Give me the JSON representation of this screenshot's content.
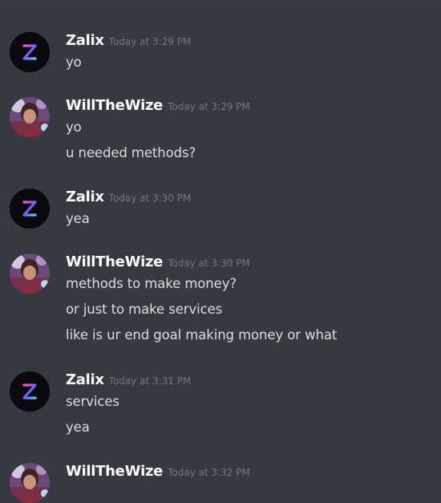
{
  "messages": [
    {
      "author": "Zalix",
      "timestamp": "Today at 3:29 PM",
      "avatar_icon": "z-logo-avatar",
      "lines": [
        "yo"
      ]
    },
    {
      "author": "WillTheWize",
      "timestamp": "Today at 3:29 PM",
      "avatar_icon": "user-photo-avatar",
      "lines": [
        "yo",
        "u needed methods?"
      ]
    },
    {
      "author": "Zalix",
      "timestamp": "Today at 3:30 PM",
      "avatar_icon": "z-logo-avatar",
      "lines": [
        "yea"
      ]
    },
    {
      "author": "WillTheWize",
      "timestamp": "Today at 3:30 PM",
      "avatar_icon": "user-photo-avatar",
      "lines": [
        "methods to make money?",
        "or just to make services",
        "like is ur end goal making money or what"
      ]
    },
    {
      "author": "Zalix",
      "timestamp": "Today at 3:31 PM",
      "avatar_icon": "z-logo-avatar",
      "lines": [
        "services",
        "yea"
      ]
    },
    {
      "author": "WillTheWize",
      "timestamp": "Today at 3:32 PM",
      "avatar_icon": "user-photo-avatar",
      "lines": []
    }
  ]
}
